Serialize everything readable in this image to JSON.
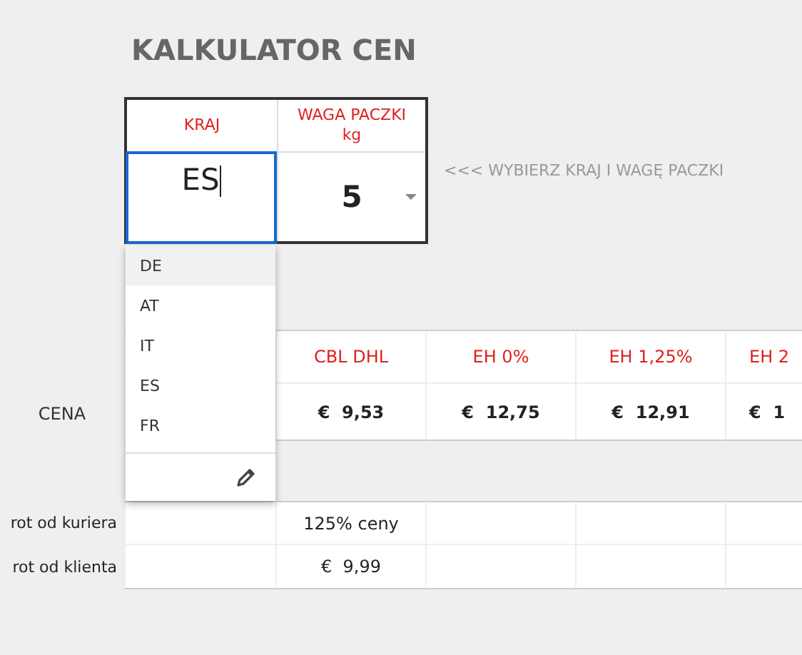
{
  "title": "KALKULATOR CEN",
  "calculator": {
    "columns": [
      {
        "label": "KRAJ"
      },
      {
        "label": "WAGA PACZKI",
        "unit": "kg"
      }
    ],
    "country": {
      "value": "ES",
      "focused": true
    },
    "weight": {
      "value": "5"
    },
    "hint": "<<< WYBIERZ KRAJ I WAGĘ PACZKI"
  },
  "dropdown": {
    "options": [
      {
        "label": "DE",
        "selected": true
      },
      {
        "label": "AT",
        "selected": false
      },
      {
        "label": "IT",
        "selected": false
      },
      {
        "label": "ES",
        "selected": false
      },
      {
        "label": "FR",
        "selected": false
      }
    ]
  },
  "prices": {
    "row_label": "CENA",
    "columns": [
      {
        "header": "CBL DHL",
        "value": "€  9,53"
      },
      {
        "header": "EH 0%",
        "value": "€  12,75"
      },
      {
        "header": "EH 1,25%",
        "value": "€  12,91"
      },
      {
        "header": "EH 2",
        "value": "€  1"
      }
    ]
  },
  "returns": [
    {
      "label": "rot od kuriera",
      "value": "125% ceny"
    },
    {
      "label": "rot od klienta",
      "value": "€  9,99"
    }
  ]
}
